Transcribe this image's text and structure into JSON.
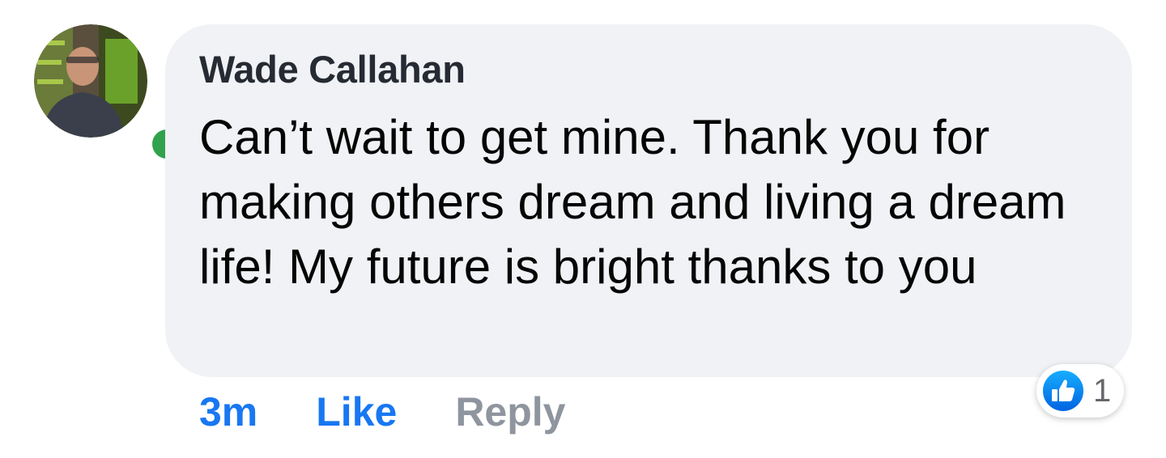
{
  "comment": {
    "author": "Wade Callahan",
    "text": "Can’t wait to get mine. Thank you for making others dream and living a dream life! My future is bright thanks to you",
    "online": true
  },
  "actions": {
    "timestamp": "3m",
    "like_label": "Like",
    "reply_label": "Reply"
  },
  "reactions": {
    "icon": "thumbs-up-icon",
    "count": "1"
  },
  "colors": {
    "bubble": "#f0f2f5",
    "accent": "#1877f2",
    "muted": "#8f959e",
    "online": "#31a24c"
  }
}
